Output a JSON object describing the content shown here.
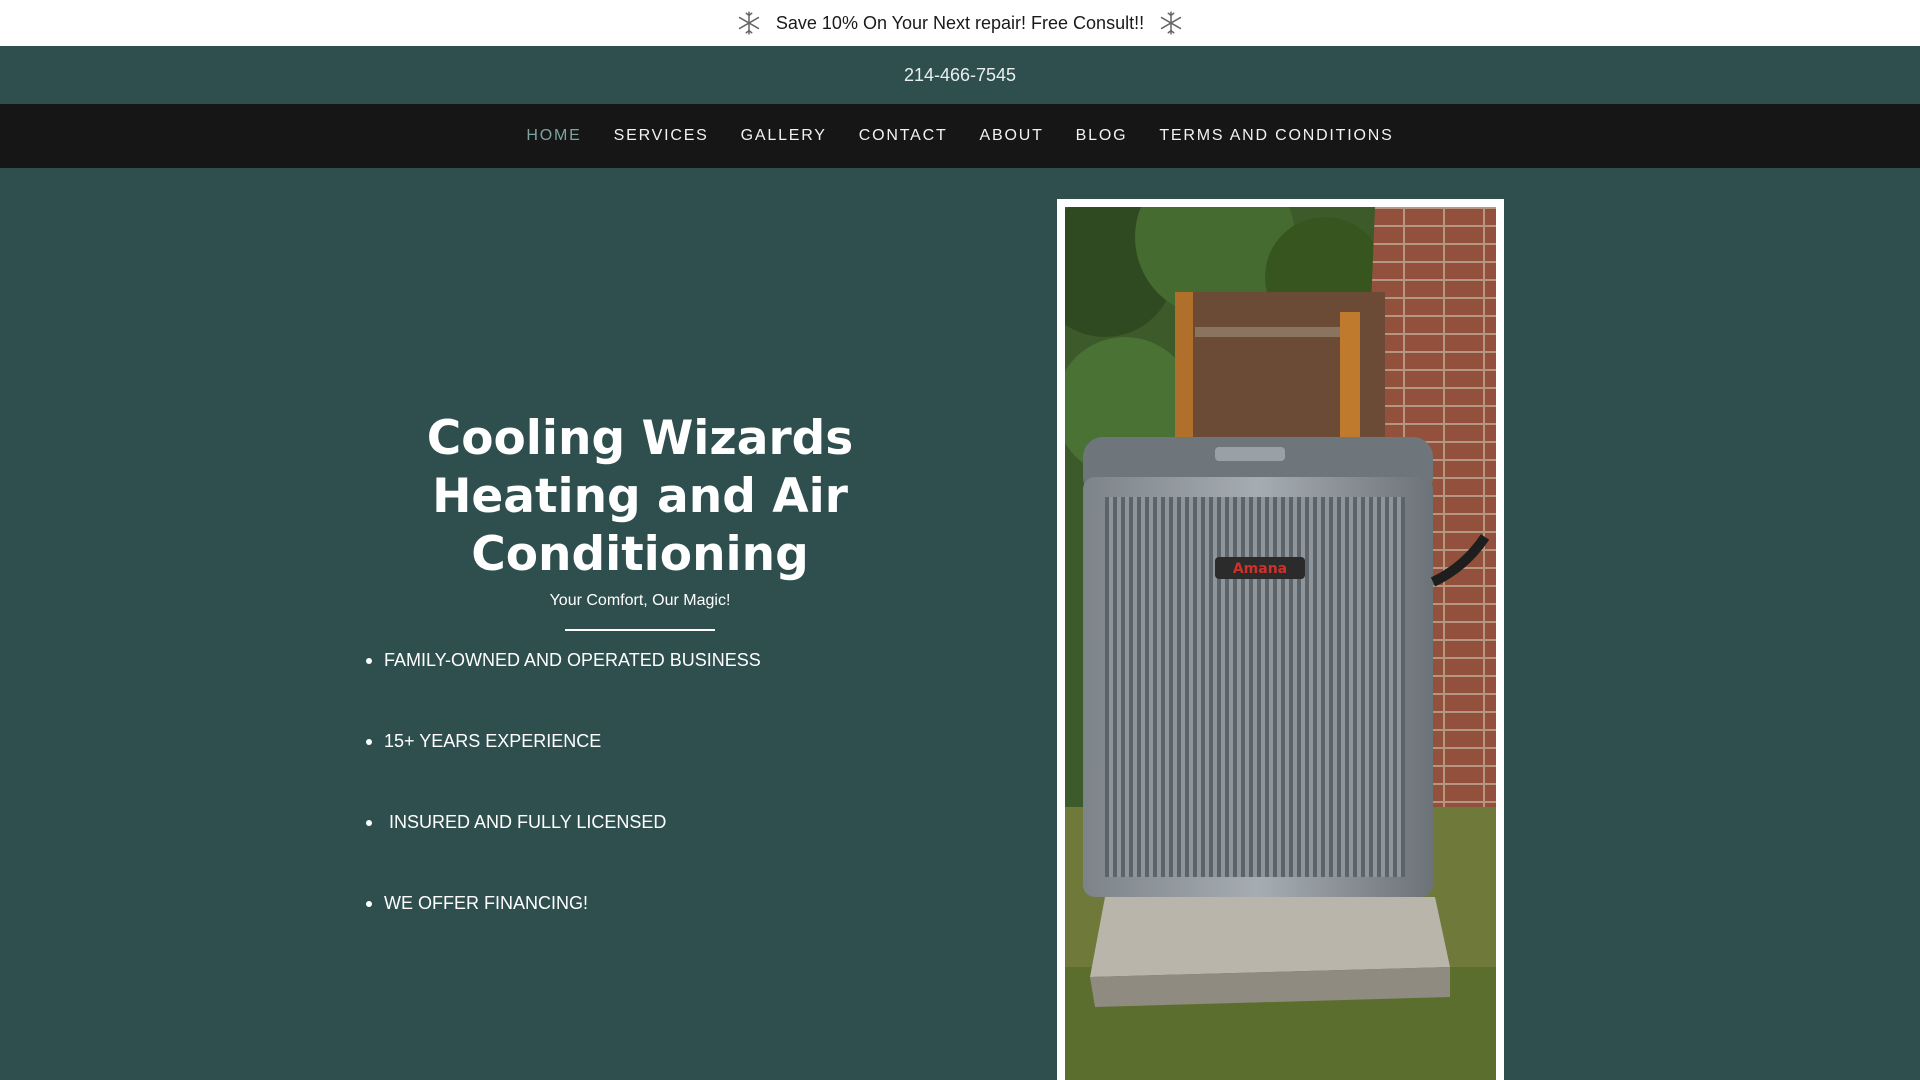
{
  "promo": {
    "text": "Save 10% On Your Next repair! Free Consult!!",
    "icon_left": "snowflake-icon",
    "icon_right": "snowflake-icon"
  },
  "phone": "214-466-7545",
  "nav": {
    "items": [
      {
        "label": "HOME",
        "active": true
      },
      {
        "label": "SERVICES"
      },
      {
        "label": "GALLERY"
      },
      {
        "label": "CONTACT"
      },
      {
        "label": "ABOUT"
      },
      {
        "label": "BLOG"
      },
      {
        "label": "TERMS AND CONDITIONS"
      }
    ]
  },
  "hero": {
    "title": "Cooling Wizards Heating and Air Conditioning",
    "tagline": "Your Comfort, Our Magic!",
    "bullets": [
      "FAMILY-OWNED AND OPERATED BUSINESS",
      "15+ YEARS EXPERIENCE",
      " INSURED AND FULLY LICENSED",
      "WE OFFER FINANCING!"
    ],
    "image": "air-conditioner-unit-photo"
  },
  "colors": {
    "primary_bg": "#2f4f4f",
    "nav_bg": "#161616",
    "nav_active": "#7fa3a0",
    "promo_bg": "#ffffff"
  }
}
